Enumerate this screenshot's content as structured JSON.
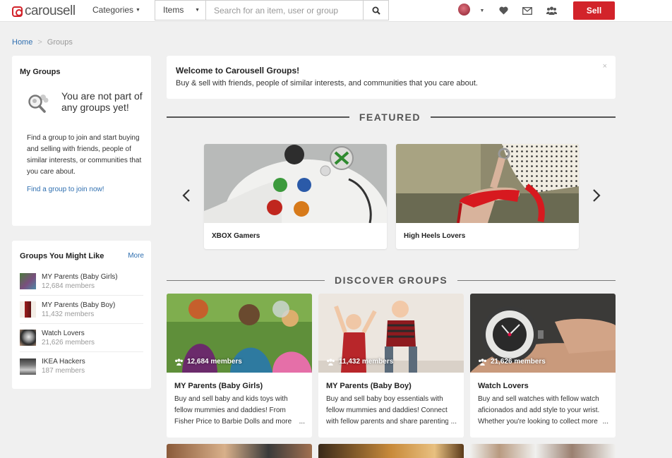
{
  "brand": {
    "name": "carousell",
    "accent": "#d2232a",
    "link": "#2f6fb0"
  },
  "nav": {
    "categories_label": "Categories",
    "search_type": "Items",
    "search_placeholder": "Search for an item, user or group",
    "sell_label": "Sell",
    "icons": [
      "search-icon",
      "avatar",
      "heart-icon",
      "mail-icon",
      "groups-icon"
    ]
  },
  "breadcrumb": {
    "home": "Home",
    "current": "Groups"
  },
  "my_groups": {
    "title": "My Groups",
    "empty_title": "You are not part of any groups yet!",
    "empty_desc": "Find a group to join and start buying and selling with friends, people of similar interests, or communities that you care about.",
    "cta": "Find a group to join now!"
  },
  "might_like": {
    "title": "Groups You Might Like",
    "more": "More",
    "items": [
      {
        "name": "MY Parents (Baby Girls)",
        "members": "12,684 members"
      },
      {
        "name": "MY Parents (Baby Boy)",
        "members": "11,432 members"
      },
      {
        "name": "Watch Lovers",
        "members": "21,626 members"
      },
      {
        "name": "IKEA Hackers",
        "members": "187 members"
      }
    ]
  },
  "welcome": {
    "title": "Welcome to Carousell Groups!",
    "text": "Buy & sell with friends, people of similar interests, and communities that you care about.",
    "close": "×"
  },
  "featured": {
    "heading": "FEATURED",
    "cards": [
      {
        "name": "XBOX Gamers"
      },
      {
        "name": "High Heels Lovers"
      }
    ]
  },
  "discover": {
    "heading": "DISCOVER GROUPS",
    "cards": [
      {
        "name": "MY Parents (Baby Girls)",
        "members": "12,684 members",
        "desc": "Buy and sell baby and kids toys with fellow mummies and daddies! From Fisher Price to Barbie Dolls and more"
      },
      {
        "name": "MY Parents (Baby Boy)",
        "members": "11,432 members",
        "desc": "Buy and sell baby boy essentials with fellow mummies and daddies! Connect with fellow parents and share parenting"
      },
      {
        "name": "Watch Lovers",
        "members": "21,626 members",
        "desc": "Buy and sell watches with fellow watch aficionados and add style to your wrist. Whether you're looking to collect more"
      }
    ],
    "ellipsis": "..."
  }
}
